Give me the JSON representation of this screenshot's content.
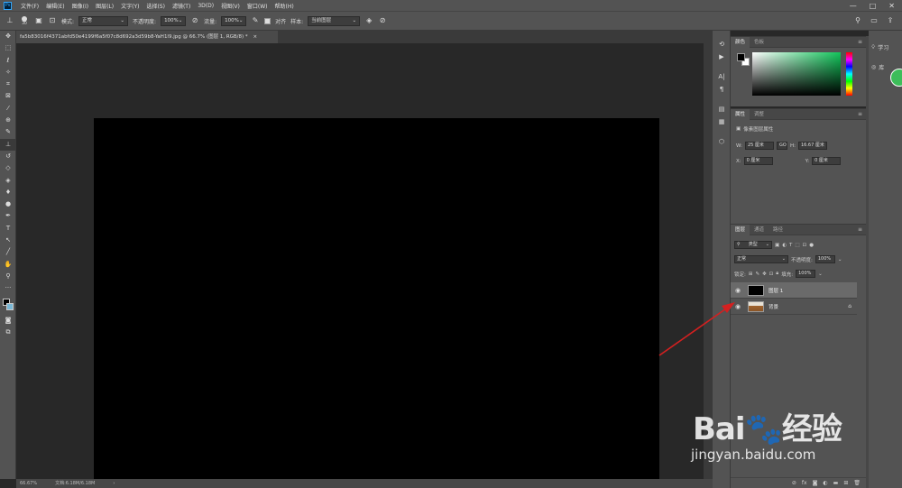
{
  "menubar": {
    "logo": "Ps",
    "items": [
      "文件(F)",
      "编辑(E)",
      "图像(I)",
      "图层(L)",
      "文字(Y)",
      "选择(S)",
      "滤镜(T)",
      "3D(D)",
      "视图(V)",
      "窗口(W)",
      "帮助(H)"
    ],
    "window_buttons": [
      "—",
      "□",
      "✕"
    ]
  },
  "options": {
    "brush_size": "30",
    "mode_label": "模式:",
    "mode_value": "正常",
    "opacity_label": "不透明度:",
    "opacity_value": "100%",
    "flow_label": "流量:",
    "flow_value": "100%",
    "align_label": "对齐",
    "sample_label": "样本:",
    "sample_value": "当前图层"
  },
  "document": {
    "tab_title": "fa5b83016f4371abfd50e4199f6a5f07c8d692a3d59b8-YaH1l9.jpg @ 66.7% (图层 1, RGB/8) *",
    "tab_close": "×",
    "zoom": "66.67%",
    "doc_size": "文档:6.18M/6.18M"
  },
  "color_panel": {
    "tabs": [
      "颜色",
      "色板"
    ],
    "menu_icon": "≡"
  },
  "properties_panel": {
    "tabs": [
      "属性",
      "调整"
    ],
    "section_label": "像素图层属性",
    "w_label": "W:",
    "w_value": "25 厘米",
    "link_icon": "GO",
    "h_label": "H:",
    "h_value": "16.67 厘米",
    "x_label": "X:",
    "x_value": "0 厘米",
    "y_label": "Y:",
    "y_value": "0 厘米"
  },
  "layers_panel": {
    "tabs": [
      "图层",
      "通道",
      "路径"
    ],
    "filter_kind": "类型",
    "blend_mode": "正常",
    "opacity_label": "不透明度:",
    "opacity_value": "100%",
    "lock_label": "锁定:",
    "fill_label": "填充:",
    "fill_value": "100%",
    "layers": [
      {
        "name": "图层 1",
        "selected": true
      },
      {
        "name": "背景",
        "selected": false
      }
    ]
  },
  "right_strip": {
    "learn_label": "学习",
    "library_label": "库"
  },
  "watermark": {
    "brand": "Bai🐾经验",
    "url": "jingyan.baidu.com"
  },
  "colors": {
    "annotation_arrow": "#d42020",
    "canvas": "#000000",
    "selected_layer": "#6a6a6a"
  }
}
